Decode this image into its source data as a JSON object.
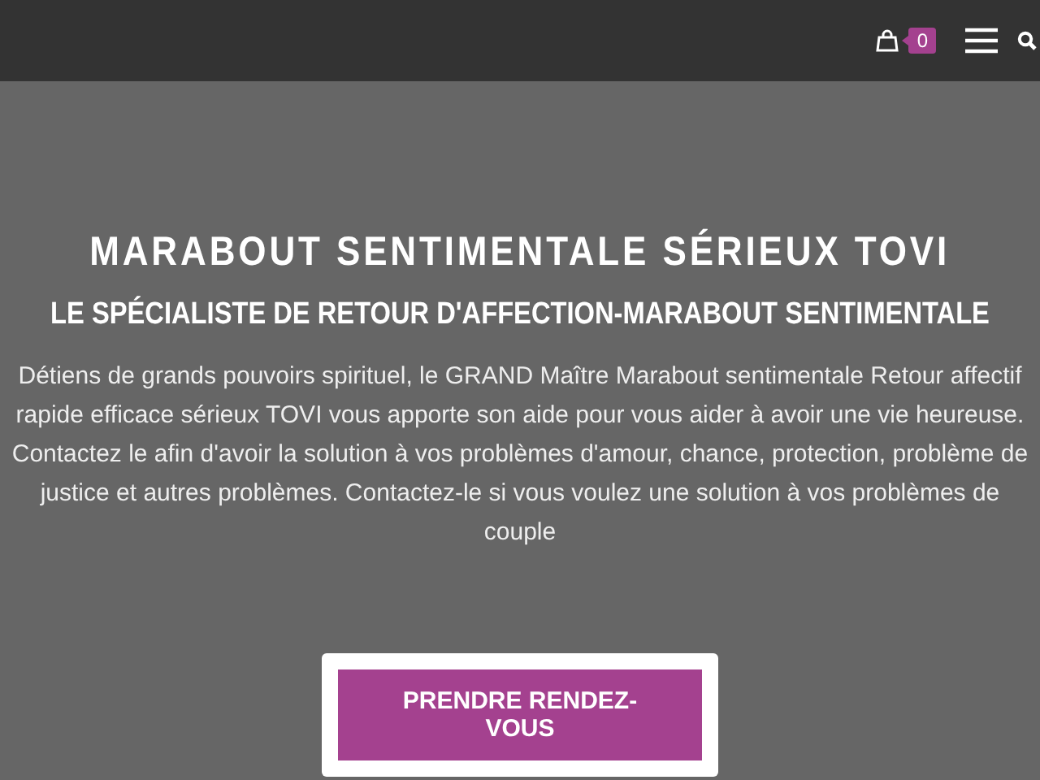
{
  "header": {
    "cart_count": "0"
  },
  "hero": {
    "title": "MARABOUT SENTIMENTALE SÉRIEUX TOVI",
    "subtitle": "LE SPÉCIALISTE DE RETOUR D'AFFECTION-MARABOUT SENTIMENTALE",
    "description": "Détiens de grands pouvoirs spirituel, le GRAND Maître Marabout sentimentale Retour affectif rapide efficace sérieux TOVI vous apporte son aide pour vous aider à avoir une vie heureuse. Contactez le afin d'avoir la solution à vos problèmes d'amour, chance, protection, problème de justice et autres problèmes. Contactez-le si vous voulez une solution à vos problèmes de couple",
    "button": "PRENDRE RENDEZ-VOUS"
  }
}
